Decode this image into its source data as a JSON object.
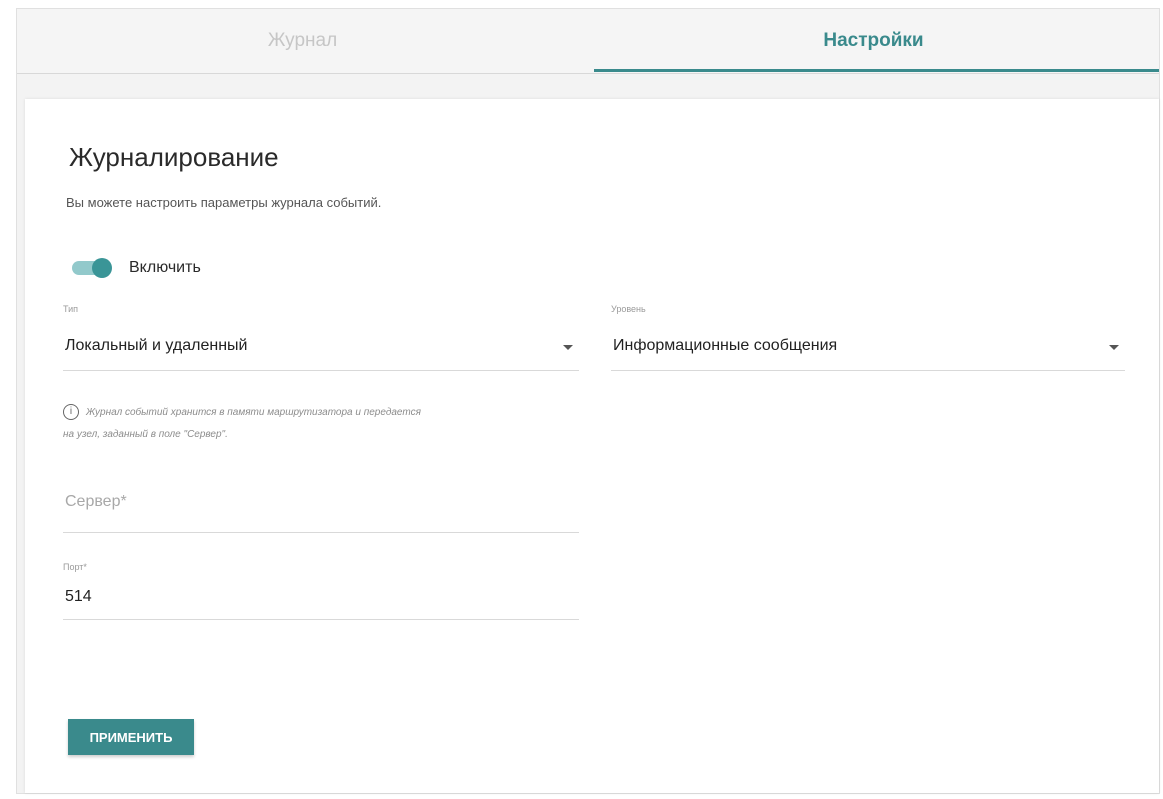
{
  "tabs": [
    {
      "label": "Журнал",
      "active": false
    },
    {
      "label": "Настройки",
      "active": true
    }
  ],
  "section": {
    "title": "Журналирование",
    "description": "Вы можете настроить параметры журнала событий."
  },
  "enable": {
    "label": "Включить",
    "on": true
  },
  "type_field": {
    "label": "Тип",
    "value": "Локальный и удаленный"
  },
  "level_field": {
    "label": "Уровень",
    "value": "Информационные сообщения"
  },
  "hint": {
    "icon": "info-icon",
    "line1": "Журнал событий хранится в памяти маршрутизатора и передается",
    "line2": "на узел, заданный в поле \"Сервер\"."
  },
  "server_field": {
    "placeholder": "Сервер*",
    "value": ""
  },
  "port_field": {
    "label": "Порт*",
    "value": "514"
  },
  "apply_button": {
    "label": "ПРИМЕНИТЬ"
  },
  "colors": {
    "accent": "#3a8a8c",
    "switch_track": "#92c9cb",
    "inactive_tab": "#c6c6c6"
  }
}
